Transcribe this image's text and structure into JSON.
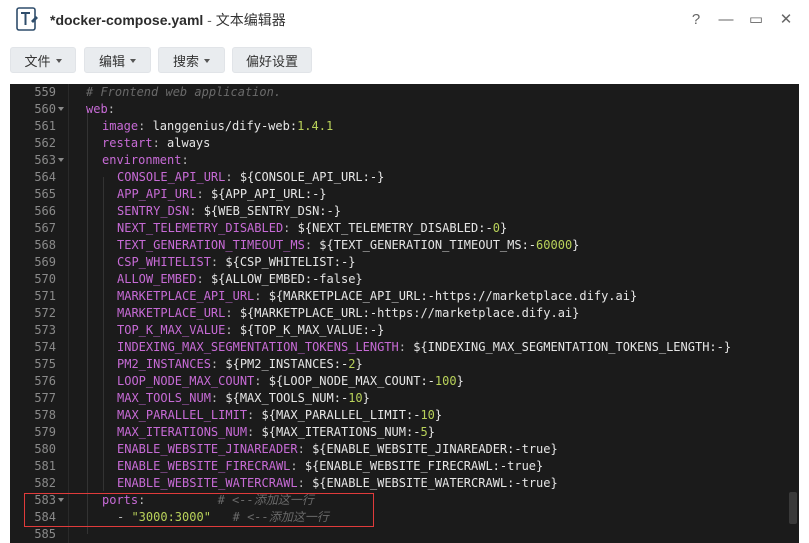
{
  "window": {
    "filename": "*docker-compose.yaml",
    "separator": " - ",
    "app_name": "文本编辑器",
    "controls": [
      "?",
      "—",
      "▭",
      "✕"
    ]
  },
  "toolbar": {
    "file_label": "文件",
    "edit_label": "编辑",
    "search_label": "搜索",
    "prefs_label": "偏好设置"
  },
  "editor": {
    "lines": [
      {
        "n": "559",
        "fold": false,
        "indent": 0,
        "parts": [
          [
            "c-comment",
            "# Frontend web application."
          ]
        ]
      },
      {
        "n": "560",
        "fold": true,
        "indent": 0,
        "parts": [
          [
            "c-key",
            "web"
          ],
          [
            "c-punc",
            ":"
          ]
        ]
      },
      {
        "n": "561",
        "fold": false,
        "indent": 1,
        "parts": [
          [
            "c-key",
            "image"
          ],
          [
            "c-punc",
            ": "
          ],
          [
            "c-val",
            "langgenius/dify-web:"
          ],
          [
            "c-num",
            "1.4.1"
          ]
        ]
      },
      {
        "n": "562",
        "fold": false,
        "indent": 1,
        "parts": [
          [
            "c-key",
            "restart"
          ],
          [
            "c-punc",
            ": "
          ],
          [
            "c-val",
            "always"
          ]
        ]
      },
      {
        "n": "563",
        "fold": true,
        "indent": 1,
        "parts": [
          [
            "c-key",
            "environment"
          ],
          [
            "c-punc",
            ":"
          ]
        ]
      },
      {
        "n": "564",
        "fold": false,
        "indent": 2,
        "parts": [
          [
            "c-key",
            "CONSOLE_API_URL"
          ],
          [
            "c-punc",
            ": "
          ],
          [
            "c-val",
            "${CONSOLE_API_URL:-}"
          ]
        ]
      },
      {
        "n": "565",
        "fold": false,
        "indent": 2,
        "parts": [
          [
            "c-key",
            "APP_API_URL"
          ],
          [
            "c-punc",
            ": "
          ],
          [
            "c-val",
            "${APP_API_URL:-}"
          ]
        ]
      },
      {
        "n": "566",
        "fold": false,
        "indent": 2,
        "parts": [
          [
            "c-key",
            "SENTRY_DSN"
          ],
          [
            "c-punc",
            ": "
          ],
          [
            "c-val",
            "${WEB_SENTRY_DSN:-}"
          ]
        ]
      },
      {
        "n": "567",
        "fold": false,
        "indent": 2,
        "parts": [
          [
            "c-key",
            "NEXT_TELEMETRY_DISABLED"
          ],
          [
            "c-punc",
            ": "
          ],
          [
            "c-val",
            "${NEXT_TELEMETRY_DISABLED:-"
          ],
          [
            "c-num",
            "0"
          ],
          [
            "c-val",
            "}"
          ]
        ]
      },
      {
        "n": "568",
        "fold": false,
        "indent": 2,
        "parts": [
          [
            "c-key",
            "TEXT_GENERATION_TIMEOUT_MS"
          ],
          [
            "c-punc",
            ": "
          ],
          [
            "c-val",
            "${TEXT_GENERATION_TIMEOUT_MS:-"
          ],
          [
            "c-num",
            "60000"
          ],
          [
            "c-val",
            "}"
          ]
        ]
      },
      {
        "n": "569",
        "fold": false,
        "indent": 2,
        "parts": [
          [
            "c-key",
            "CSP_WHITELIST"
          ],
          [
            "c-punc",
            ": "
          ],
          [
            "c-val",
            "${CSP_WHITELIST:-}"
          ]
        ]
      },
      {
        "n": "570",
        "fold": false,
        "indent": 2,
        "parts": [
          [
            "c-key",
            "ALLOW_EMBED"
          ],
          [
            "c-punc",
            ": "
          ],
          [
            "c-val",
            "${ALLOW_EMBED:-false}"
          ]
        ]
      },
      {
        "n": "571",
        "fold": false,
        "indent": 2,
        "parts": [
          [
            "c-key",
            "MARKETPLACE_API_URL"
          ],
          [
            "c-punc",
            ": "
          ],
          [
            "c-val",
            "${MARKETPLACE_API_URL:-https://marketplace.dify.ai}"
          ]
        ]
      },
      {
        "n": "572",
        "fold": false,
        "indent": 2,
        "parts": [
          [
            "c-key",
            "MARKETPLACE_URL"
          ],
          [
            "c-punc",
            ": "
          ],
          [
            "c-val",
            "${MARKETPLACE_URL:-https://marketplace.dify.ai}"
          ]
        ]
      },
      {
        "n": "573",
        "fold": false,
        "indent": 2,
        "parts": [
          [
            "c-key",
            "TOP_K_MAX_VALUE"
          ],
          [
            "c-punc",
            ": "
          ],
          [
            "c-val",
            "${TOP_K_MAX_VALUE:-}"
          ]
        ]
      },
      {
        "n": "574",
        "fold": false,
        "indent": 2,
        "parts": [
          [
            "c-key",
            "INDEXING_MAX_SEGMENTATION_TOKENS_LENGTH"
          ],
          [
            "c-punc",
            ": "
          ],
          [
            "c-val",
            "${INDEXING_MAX_SEGMENTATION_TOKENS_LENGTH:-}"
          ]
        ]
      },
      {
        "n": "575",
        "fold": false,
        "indent": 2,
        "parts": [
          [
            "c-key",
            "PM2_INSTANCES"
          ],
          [
            "c-punc",
            ": "
          ],
          [
            "c-val",
            "${PM2_INSTANCES:-"
          ],
          [
            "c-num",
            "2"
          ],
          [
            "c-val",
            "}"
          ]
        ]
      },
      {
        "n": "576",
        "fold": false,
        "indent": 2,
        "parts": [
          [
            "c-key",
            "LOOP_NODE_MAX_COUNT"
          ],
          [
            "c-punc",
            ": "
          ],
          [
            "c-val",
            "${LOOP_NODE_MAX_COUNT:-"
          ],
          [
            "c-num",
            "100"
          ],
          [
            "c-val",
            "}"
          ]
        ]
      },
      {
        "n": "577",
        "fold": false,
        "indent": 2,
        "parts": [
          [
            "c-key",
            "MAX_TOOLS_NUM"
          ],
          [
            "c-punc",
            ": "
          ],
          [
            "c-val",
            "${MAX_TOOLS_NUM:-"
          ],
          [
            "c-num",
            "10"
          ],
          [
            "c-val",
            "}"
          ]
        ]
      },
      {
        "n": "578",
        "fold": false,
        "indent": 2,
        "parts": [
          [
            "c-key",
            "MAX_PARALLEL_LIMIT"
          ],
          [
            "c-punc",
            ": "
          ],
          [
            "c-val",
            "${MAX_PARALLEL_LIMIT:-"
          ],
          [
            "c-num",
            "10"
          ],
          [
            "c-val",
            "}"
          ]
        ]
      },
      {
        "n": "579",
        "fold": false,
        "indent": 2,
        "parts": [
          [
            "c-key",
            "MAX_ITERATIONS_NUM"
          ],
          [
            "c-punc",
            ": "
          ],
          [
            "c-val",
            "${MAX_ITERATIONS_NUM:-"
          ],
          [
            "c-num",
            "5"
          ],
          [
            "c-val",
            "}"
          ]
        ]
      },
      {
        "n": "580",
        "fold": false,
        "indent": 2,
        "parts": [
          [
            "c-key",
            "ENABLE_WEBSITE_JINAREADER"
          ],
          [
            "c-punc",
            ": "
          ],
          [
            "c-val",
            "${ENABLE_WEBSITE_JINAREADER:-true}"
          ]
        ]
      },
      {
        "n": "581",
        "fold": false,
        "indent": 2,
        "parts": [
          [
            "c-key",
            "ENABLE_WEBSITE_FIRECRAWL"
          ],
          [
            "c-punc",
            ": "
          ],
          [
            "c-val",
            "${ENABLE_WEBSITE_FIRECRAWL:-true}"
          ]
        ]
      },
      {
        "n": "582",
        "fold": false,
        "indent": 2,
        "parts": [
          [
            "c-key",
            "ENABLE_WEBSITE_WATERCRAWL"
          ],
          [
            "c-punc",
            ": "
          ],
          [
            "c-val",
            "${ENABLE_WEBSITE_WATERCRAWL:-true}"
          ]
        ]
      },
      {
        "n": "583",
        "fold": true,
        "indent": 1,
        "parts": [
          [
            "c-key",
            "ports"
          ],
          [
            "c-punc",
            ":          "
          ],
          [
            "c-comment",
            "# <--添加这一行"
          ]
        ]
      },
      {
        "n": "584",
        "fold": false,
        "indent": 2,
        "parts": [
          [
            "c-punc",
            "- "
          ],
          [
            "c-str",
            "\"3000:3000\""
          ],
          [
            "c-punc",
            "   "
          ],
          [
            "c-comment",
            "# <--添加这一行"
          ]
        ]
      },
      {
        "n": "585",
        "fold": false,
        "indent": 0,
        "parts": []
      }
    ]
  },
  "colors": {
    "editor_bg": "#1b1b1b",
    "key": "#c76bd6",
    "number": "#b9d25a",
    "comment": "#6a6a6a",
    "highlight_border": "#e03b3b"
  }
}
